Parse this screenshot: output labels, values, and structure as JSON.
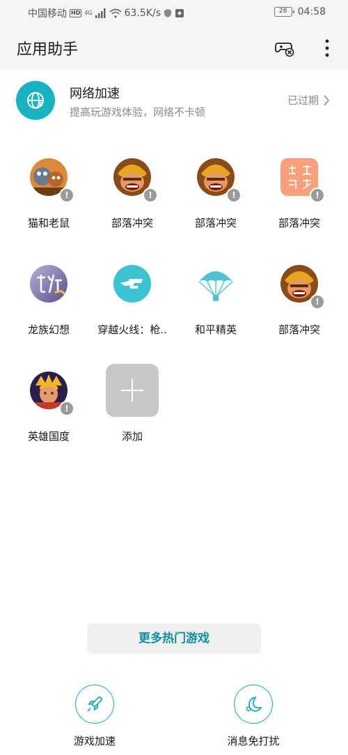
{
  "status_bar": {
    "carrier": "中国移动",
    "hd": "HD",
    "network": "4G",
    "speed": "63.5K/s",
    "battery": "28",
    "time": "04:58"
  },
  "header": {
    "title": "应用助手"
  },
  "network_boost": {
    "title": "网络加速",
    "subtitle": "提高玩游戏体验，网络不卡顿",
    "status": "已过期"
  },
  "games": [
    {
      "label": "猫和老鼠",
      "icon": "tom-and-jerry-icon"
    },
    {
      "label": "部落冲突",
      "icon": "clash-of-clans-icon"
    },
    {
      "label": "部落冲突",
      "icon": "clash-of-clans-icon"
    },
    {
      "label": "部落冲突",
      "icon": "clash-of-clans-text-icon"
    },
    {
      "label": "龙族幻想",
      "icon": "dragon-raja-icon"
    },
    {
      "label": "穿越火线：枪..",
      "icon": "crossfire-icon"
    },
    {
      "label": "和平精英",
      "icon": "parachute-icon"
    },
    {
      "label": "部落冲突",
      "icon": "clash-of-clans-icon"
    },
    {
      "label": "英雄国度",
      "icon": "hero-kingdom-icon"
    }
  ],
  "add_tile": {
    "label": "添加"
  },
  "more_games_button": "更多热门游戏",
  "bottom_actions": [
    {
      "label": "游戏加速",
      "icon": "rocket-icon"
    },
    {
      "label": "消息免打扰",
      "icon": "moon-icon"
    }
  ],
  "colors": {
    "accent": "#19b2c0",
    "button_text": "#0f8e9c",
    "badge": "#9a9a9a"
  }
}
